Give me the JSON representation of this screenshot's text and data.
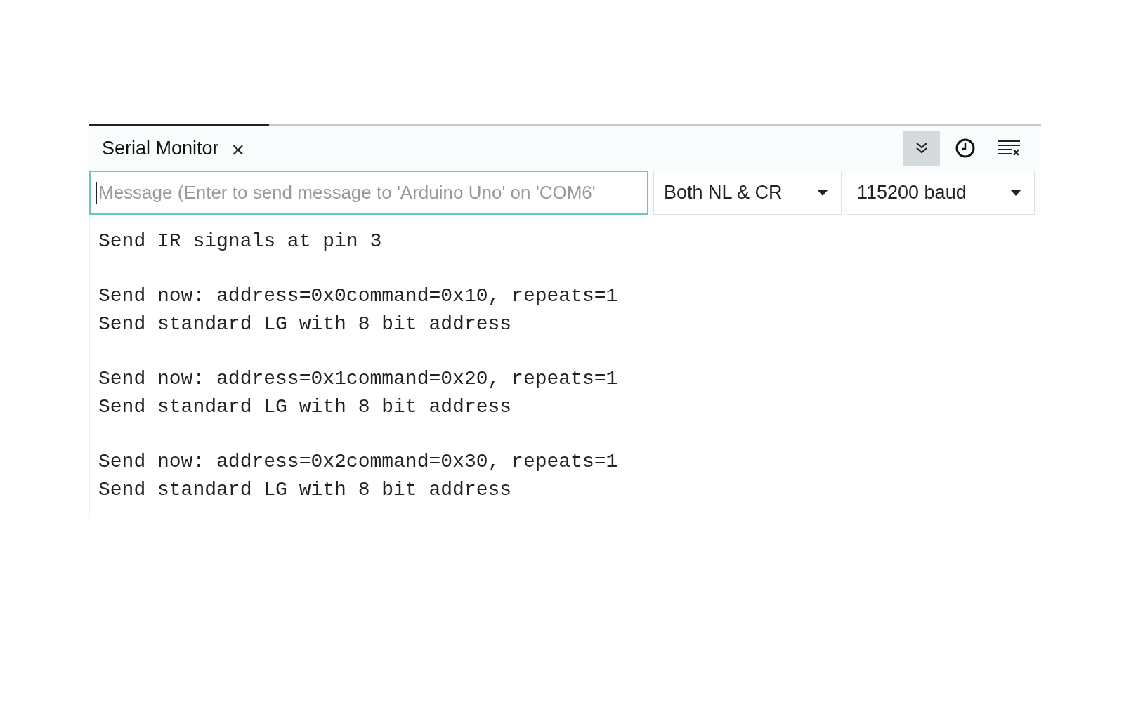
{
  "tab": {
    "title": "Serial Monitor",
    "close": "×",
    "selected": true
  },
  "toolbar": [
    {
      "kind": "autoscroll",
      "on": true
    },
    {
      "kind": "timestamp",
      "on": false
    },
    {
      "kind": "clear",
      "on": false
    }
  ],
  "message_field": {
    "placeholder": "Message (Enter to send message to 'Arduino Uno' on 'COM6'",
    "focused": true
  },
  "line_ending": {
    "value": "Both NL & CR"
  },
  "baud_rate": {
    "value": "115200 baud"
  },
  "output": [
    {
      "lines": [
        "Send IR signals at pin 3"
      ]
    },
    {
      "lines": [
        "Send now: address=0x0command=0x10, repeats=1",
        "Send standard LG with 8 bit address"
      ]
    },
    {
      "lines": [
        "Send now: address=0x1command=0x20, repeats=1",
        "Send standard LG with 8 bit address"
      ]
    },
    {
      "lines": [
        "Send now: address=0x2command=0x30, repeats=1",
        "Send standard LG with 8 bit address"
      ]
    }
  ]
}
